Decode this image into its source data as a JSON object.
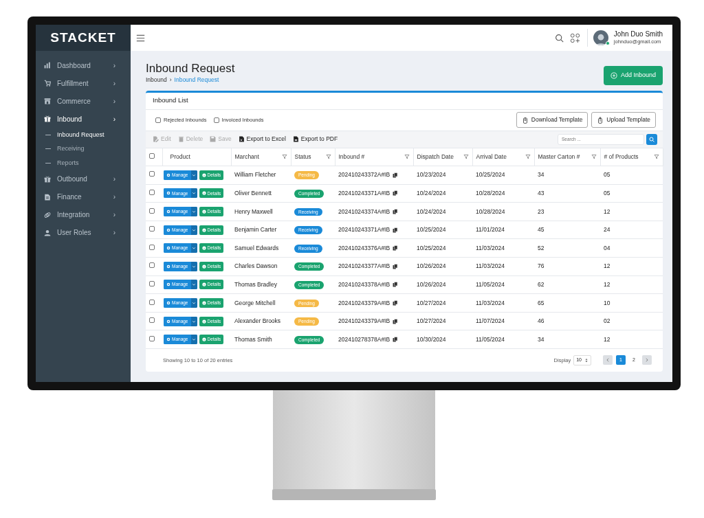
{
  "brand": "STACKET",
  "sidebar": {
    "items": [
      {
        "label": "Dashboard",
        "chevron": "›"
      },
      {
        "label": "Fulfillment",
        "chevron": "›"
      },
      {
        "label": "Commerce",
        "chevron": "›"
      },
      {
        "label": "Inbound",
        "chevron": "›",
        "active": true,
        "children": [
          {
            "label": "Inbound Request",
            "selected": true
          },
          {
            "label": "Receiving",
            "selected": false
          },
          {
            "label": "Reports",
            "selected": false
          }
        ]
      },
      {
        "label": "Outbound",
        "chevron": "›"
      },
      {
        "label": "Finance",
        "chevron": "›"
      },
      {
        "label": "Integration",
        "chevron": "›"
      },
      {
        "label": "User Roles",
        "chevron": "›"
      }
    ]
  },
  "user": {
    "name": "John Duo Smith",
    "email": "johnduo@gmail.com",
    "online": true
  },
  "page": {
    "title": "Inbound Request",
    "breadcrumb": {
      "parent": "Inbound",
      "separator": "›",
      "current": "Inbound Request"
    },
    "add_button": "Add Inbound"
  },
  "card": {
    "title": "Inbound List",
    "filters": [
      {
        "label": "Rejected Inbounds",
        "checked": false
      },
      {
        "label": "Invoiced Inbounds",
        "checked": false
      }
    ],
    "template_buttons": [
      "Download Template",
      "Upload Template"
    ],
    "toolbar": [
      {
        "label": "Edit",
        "disabled": true
      },
      {
        "label": "Delete",
        "disabled": true
      },
      {
        "label": "Save",
        "disabled": true
      },
      {
        "label": "Export to Excel",
        "disabled": false
      },
      {
        "label": "Export to PDF",
        "disabled": false
      }
    ],
    "search": {
      "placeholder": "Search ..."
    }
  },
  "table": {
    "select_all": false,
    "columns": [
      {
        "label": "Product",
        "filter": false
      },
      {
        "label": "Marchant",
        "filter": true
      },
      {
        "label": "Status",
        "filter": true
      },
      {
        "label": "Inbound #",
        "filter": true
      },
      {
        "label": "Dispatch Date",
        "filter": true
      },
      {
        "label": "Arrival Date",
        "filter": true
      },
      {
        "label": "Master Carton #",
        "filter": true
      },
      {
        "label": "# of Products",
        "filter": true
      }
    ],
    "rows": [
      {
        "selected": false,
        "manage": "Manage",
        "details": "Details",
        "merchant": "William Fletcher",
        "status": {
          "label": "Pending",
          "kind": "pending"
        },
        "inbound": "202410243372A#IB",
        "dispatch": "10/23/2024",
        "arrival": "10/25/2024",
        "cartons": "34",
        "products": "05"
      },
      {
        "selected": false,
        "manage": "Manage",
        "details": "Details",
        "merchant": "Oliver Bennett",
        "status": {
          "label": "Completed",
          "kind": "completed"
        },
        "inbound": "202410243371A#IB",
        "dispatch": "10/24/2024",
        "arrival": "10/28/2024",
        "cartons": "43",
        "products": "05"
      },
      {
        "selected": false,
        "manage": "Manage",
        "details": "Details",
        "merchant": "Henry Maxwell",
        "status": {
          "label": "Receiving",
          "kind": "receiving"
        },
        "inbound": "202410243374A#IB",
        "dispatch": "10/24/2024",
        "arrival": "10/28/2024",
        "cartons": "23",
        "products": "12"
      },
      {
        "selected": false,
        "manage": "Manage",
        "details": "Details",
        "merchant": "Benjamin Carter",
        "status": {
          "label": "Receiving",
          "kind": "receiving"
        },
        "inbound": "202410243371A#IB",
        "dispatch": "10/25/2024",
        "arrival": "11/01/2024",
        "cartons": "45",
        "products": "24"
      },
      {
        "selected": false,
        "manage": "Manage",
        "details": "Details",
        "merchant": "Samuel Edwards",
        "status": {
          "label": "Receiving",
          "kind": "receiving"
        },
        "inbound": "202410243376A#IB",
        "dispatch": "10/25/2024",
        "arrival": "11/03/2024",
        "cartons": "52",
        "products": "04"
      },
      {
        "selected": false,
        "manage": "Manage",
        "details": "Details",
        "merchant": "Charles Dawson",
        "status": {
          "label": "Completed",
          "kind": "completed"
        },
        "inbound": "202410243377A#IB",
        "dispatch": "10/26/2024",
        "arrival": "11/03/2024",
        "cartons": "76",
        "products": "12"
      },
      {
        "selected": false,
        "manage": "Manage",
        "details": "Details",
        "merchant": "Thomas Bradley",
        "status": {
          "label": "Completed",
          "kind": "completed"
        },
        "inbound": "202410243378A#IB",
        "dispatch": "10/26/2024",
        "arrival": "11/05/2024",
        "cartons": "62",
        "products": "12"
      },
      {
        "selected": false,
        "manage": "Manage",
        "details": "Details",
        "merchant": "George Mitchell",
        "status": {
          "label": "Pending",
          "kind": "pending"
        },
        "inbound": "202410243379A#IB",
        "dispatch": "10/27/2024",
        "arrival": "11/03/2024",
        "cartons": "65",
        "products": "10"
      },
      {
        "selected": false,
        "manage": "Manage",
        "details": "Details",
        "merchant": "Alexander Brooks",
        "status": {
          "label": "Pending",
          "kind": "pending"
        },
        "inbound": "202410243379A#IB",
        "dispatch": "10/27/2024",
        "arrival": "11/07/2024",
        "cartons": "46",
        "products": "02"
      },
      {
        "selected": false,
        "manage": "Manage",
        "details": "Details",
        "merchant": "Thomas Smith",
        "status": {
          "label": "Completed",
          "kind": "completed"
        },
        "inbound": "202410278378A#IB",
        "dispatch": "10/30/2024",
        "arrival": "11/05/2024",
        "cartons": "34",
        "products": "12"
      }
    ]
  },
  "footer": {
    "summary": "Showing 10 to 10 of 20 entries",
    "display_label": "Display",
    "page_size": "10",
    "pages": [
      {
        "label": "1",
        "selected": true
      },
      {
        "label": "2",
        "selected": false
      }
    ]
  }
}
